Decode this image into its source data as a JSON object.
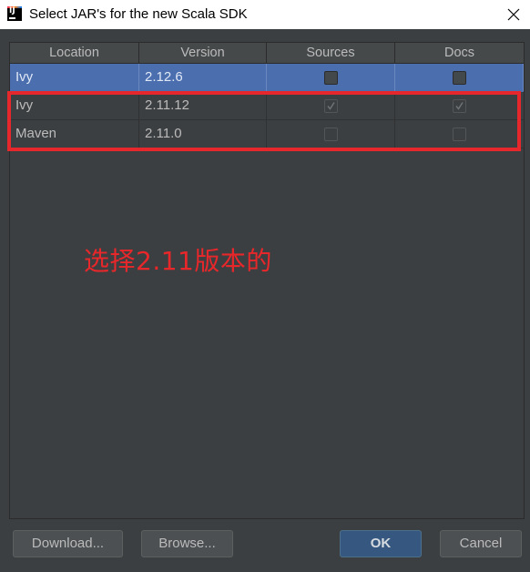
{
  "window": {
    "title": "Select JAR's for the new Scala SDK",
    "app_icon_text": "IJ"
  },
  "table": {
    "columns": [
      "Location",
      "Version",
      "Sources",
      "Docs"
    ],
    "rows": [
      {
        "location": "Ivy",
        "version": "2.12.6",
        "sources": false,
        "docs": false,
        "selected": true
      },
      {
        "location": "Ivy",
        "version": "2.11.12",
        "sources": true,
        "docs": true,
        "selected": false
      },
      {
        "location": "Maven",
        "version": "2.11.0",
        "sources": false,
        "docs": false,
        "selected": false
      }
    ]
  },
  "annotation": {
    "text": "选择2.11版本的",
    "color": "#e6272b"
  },
  "buttons": {
    "download": "Download...",
    "browse": "Browse...",
    "ok": "OK",
    "cancel": "Cancel"
  },
  "colors": {
    "background": "#3c3f41",
    "selection": "#4b6eaf",
    "primary_button": "#365880"
  }
}
